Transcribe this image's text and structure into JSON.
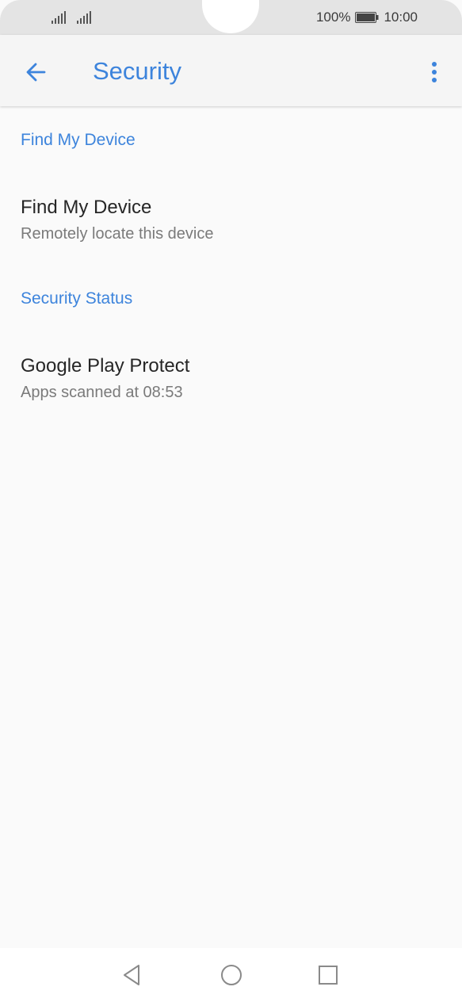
{
  "status_bar": {
    "battery_percent": "100%",
    "time": "10:00",
    "icons": [
      "signal-icon",
      "signal-icon",
      "battery-icon"
    ]
  },
  "app_bar": {
    "title": "Security",
    "back_icon": "arrow-left-icon",
    "more_icon": "more-vertical-icon"
  },
  "sections": [
    {
      "header": "Find My Device",
      "items": [
        {
          "title": "Find My Device",
          "subtitle": "Remotely locate this device"
        }
      ]
    },
    {
      "header": "Security Status",
      "items": [
        {
          "title": "Google Play Protect",
          "subtitle": "Apps scanned at 08:53"
        }
      ]
    }
  ],
  "nav_bar": {
    "icons": [
      "nav-back-icon",
      "nav-home-icon",
      "nav-recents-icon"
    ]
  },
  "colors": {
    "accent": "#3d84dc",
    "primary_text": "#262626",
    "secondary_text": "#7a7a7a",
    "background": "#fafafa"
  }
}
